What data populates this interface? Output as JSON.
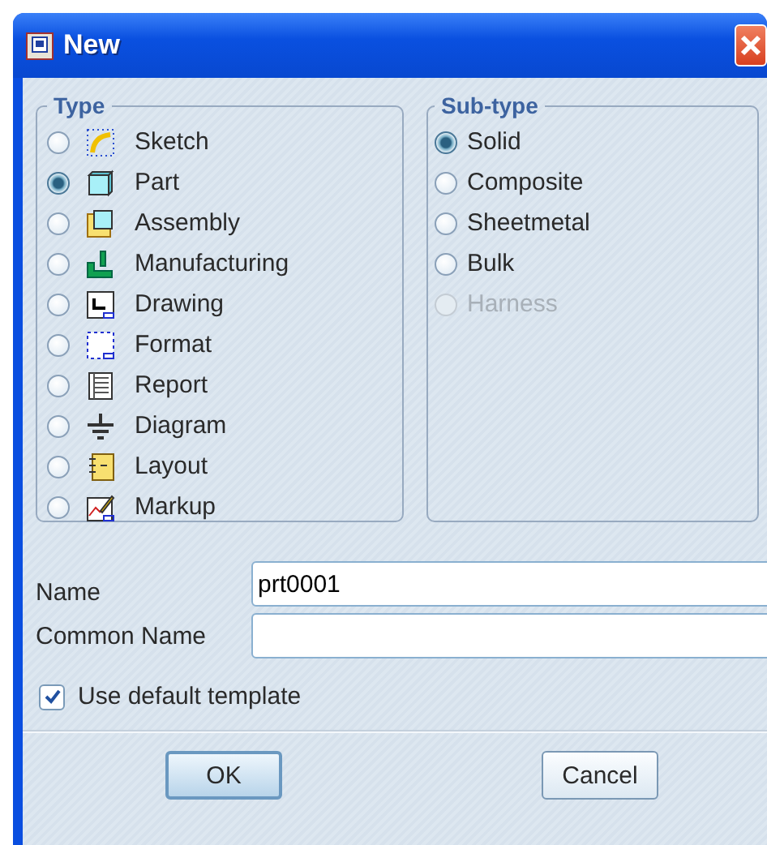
{
  "window": {
    "title": "New"
  },
  "type_group": {
    "title": "Type",
    "items": [
      {
        "label": "Sketch",
        "selected": false
      },
      {
        "label": "Part",
        "selected": true
      },
      {
        "label": "Assembly",
        "selected": false
      },
      {
        "label": "Manufacturing",
        "selected": false
      },
      {
        "label": "Drawing",
        "selected": false
      },
      {
        "label": "Format",
        "selected": false
      },
      {
        "label": "Report",
        "selected": false
      },
      {
        "label": "Diagram",
        "selected": false
      },
      {
        "label": "Layout",
        "selected": false
      },
      {
        "label": "Markup",
        "selected": false
      }
    ]
  },
  "subtype_group": {
    "title": "Sub-type",
    "items": [
      {
        "label": "Solid",
        "selected": true,
        "disabled": false
      },
      {
        "label": "Composite",
        "selected": false,
        "disabled": false
      },
      {
        "label": "Sheetmetal",
        "selected": false,
        "disabled": false
      },
      {
        "label": "Bulk",
        "selected": false,
        "disabled": false
      },
      {
        "label": "Harness",
        "selected": false,
        "disabled": true
      }
    ]
  },
  "fields": [
    {
      "label": "Name",
      "value": "prt0001"
    },
    {
      "label": "Common Name"
    }
  ],
  "use_default_template": {
    "label": "Use default template",
    "checked": true
  },
  "buttons": [
    "OK",
    "Cancel"
  ]
}
